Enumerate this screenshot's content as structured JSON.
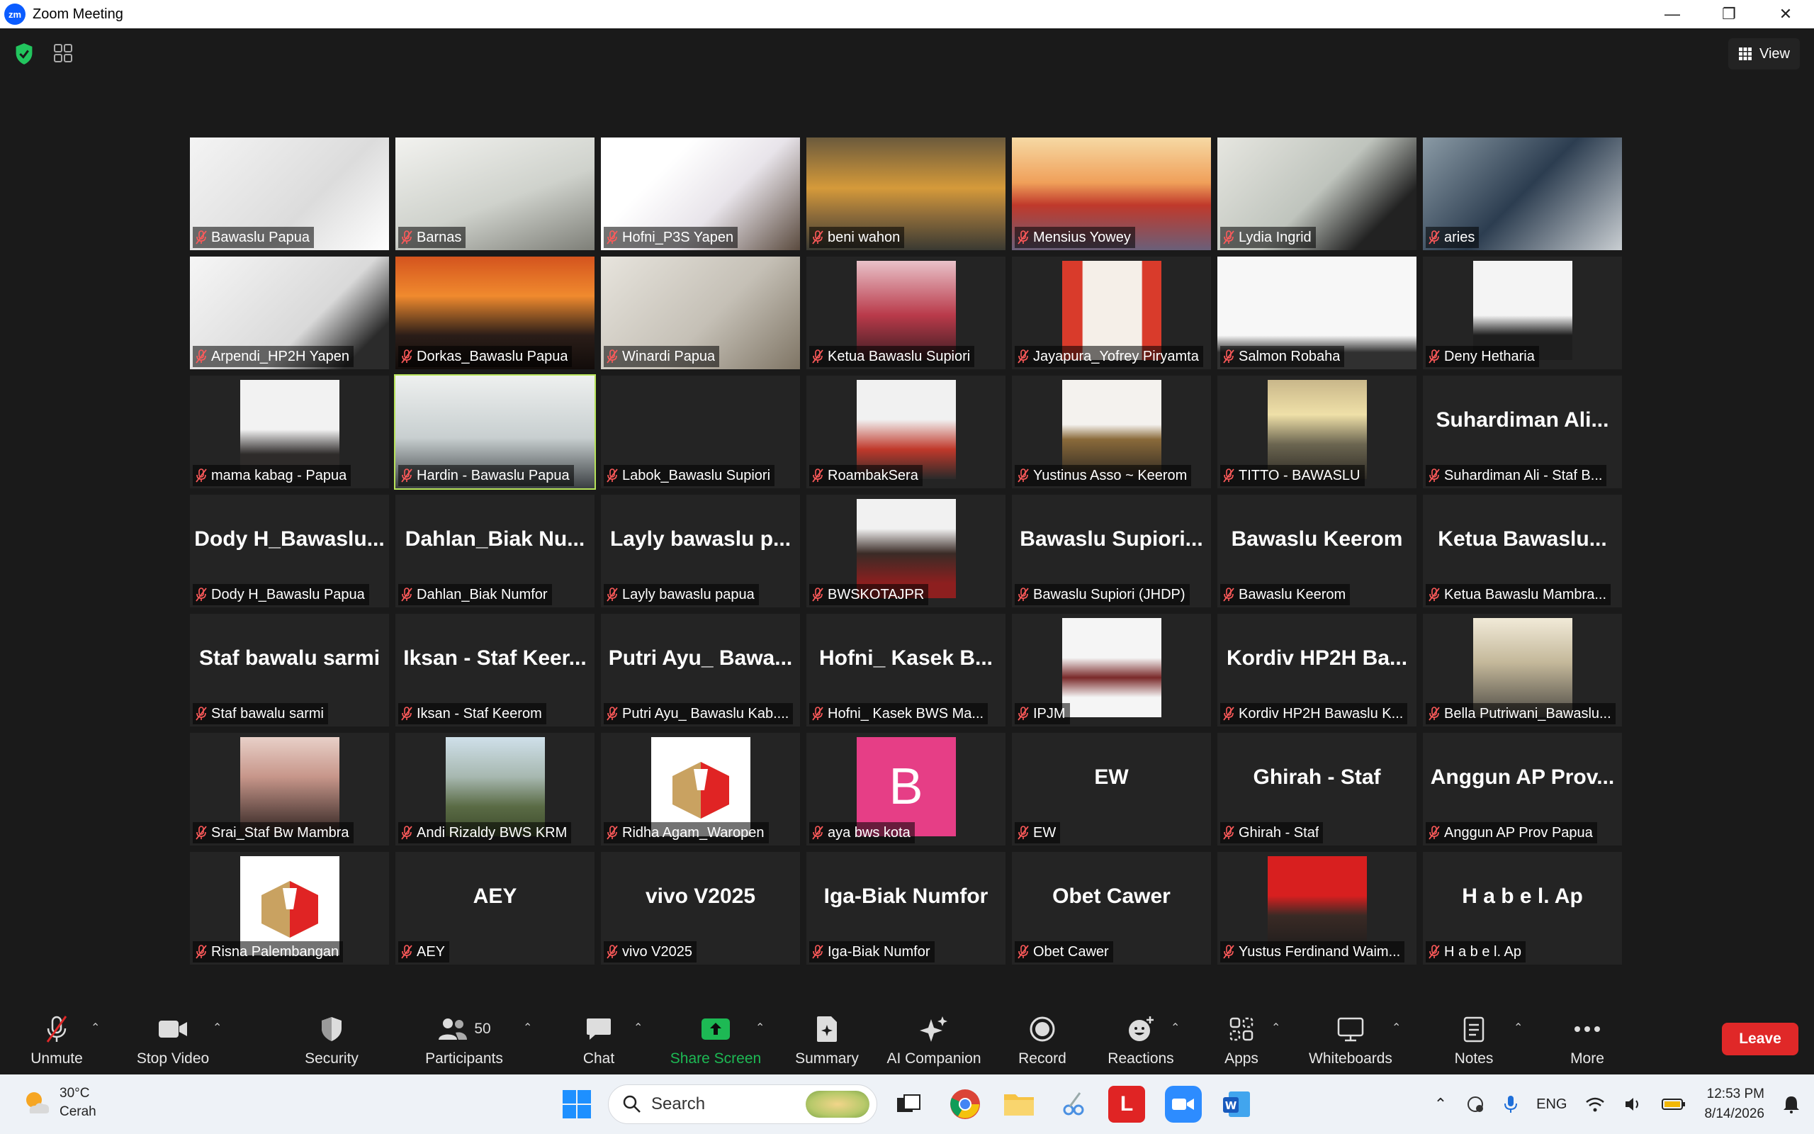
{
  "window": {
    "title": "Zoom Meeting",
    "logo_text": "zm"
  },
  "top": {
    "view_label": "View"
  },
  "tiles": [
    {
      "name": "Bawaslu Papua",
      "kind": "video",
      "bg": "linear-gradient(135deg,#f4f4f4,#dcdcdc 60%,#ffffff)"
    },
    {
      "name": "Barnas",
      "kind": "video",
      "bg": "linear-gradient(160deg,#f2f2ef,#cfd2cc 55%,#7e7f78)"
    },
    {
      "name": "Hofni_P3S Yapen",
      "kind": "video",
      "bg": "linear-gradient(135deg,#ffffff 30%,#e8e4ea 60%,#5b4b3f)"
    },
    {
      "name": "beni wahon",
      "kind": "video",
      "bg": "linear-gradient(180deg,#6b5a3c,#d59a3a 45%,#8b6a3a 70%,#3a3a32)"
    },
    {
      "name": "Mensius Yowey",
      "kind": "video",
      "bg": "linear-gradient(180deg,#f6d9a4,#f0a05a 40%,#c0392b 60%,#6a5f79)"
    },
    {
      "name": "Lydia Ingrid",
      "kind": "video",
      "bg": "linear-gradient(135deg,#e6e6e0,#bfc4bd 50%,#222 80%)"
    },
    {
      "name": "aries",
      "kind": "video",
      "bg": "linear-gradient(135deg,#8a9aa5,#2c3d50 50%,#c9ced2)"
    },
    {
      "name": "Arpendi_HP2H Yapen",
      "kind": "video",
      "bg": "linear-gradient(135deg,#f6f6f6,#d9d9d9 60%,#2b2b2b 85%)"
    },
    {
      "name": "Dorkas_Bawaslu Papua",
      "kind": "video",
      "bg": "linear-gradient(180deg,#d4541e,#f08a2e 35%,#2a1d18 70%,#120c0a)"
    },
    {
      "name": "Winardi Papua",
      "kind": "video",
      "bg": "linear-gradient(135deg,#e7e4dd,#c5c0b6 55%,#7f7565)"
    },
    {
      "name": "Ketua Bawaslu Supiori",
      "kind": "pic",
      "bg": "linear-gradient(180deg,#e9c2c9,#b93a4a 55%,#3b1d22)"
    },
    {
      "name": "Jayapura_Yofrey Piryamta",
      "kind": "pic",
      "bg": "linear-gradient(90deg,#d93b2b 20%,#f5efe8 21%,#f5efe8 80%,#d93b2b 81%)"
    },
    {
      "name": "Salmon Robaha",
      "kind": "video",
      "bg": "linear-gradient(180deg,#f7f7f7 70%,#303030 85%)"
    },
    {
      "name": "Deny Hetharia",
      "kind": "pic",
      "bg": "linear-gradient(180deg,#f4f4f4 55%,#1e1e1e 75%)"
    },
    {
      "name": "mama kabag - Papua",
      "kind": "pic",
      "bg": "linear-gradient(180deg,#f2f2f2 50%,#2e2b2a 75%)"
    },
    {
      "name": "Hardin - Bawaslu Papua",
      "kind": "video",
      "bg": "linear-gradient(180deg,#eef0ef,#c8cfd0 55%,#3a3f42)",
      "active": true
    },
    {
      "name": "Labok_Bawaslu Supiori",
      "kind": "blank"
    },
    {
      "name": "RoambakSera",
      "kind": "pic",
      "bg": "linear-gradient(180deg,#f1f1f1 40%,#c0392b 70%,#2a2a2a)"
    },
    {
      "name": "Yustinus Asso ~ Keerom",
      "kind": "pic",
      "bg": "linear-gradient(180deg,#f4f2ee 45%,#8a6a3a 60%,#2c2722)"
    },
    {
      "name": "TITTO - BAWASLU",
      "kind": "pic",
      "bg": "linear-gradient(180deg,#c9b78a,#efe0a8 35%,#6b6550 65%,#2e2b25)"
    },
    {
      "name": "Suhardiman Ali - Staf B...",
      "kind": "text",
      "display": "Suhardiman  Ali..."
    },
    {
      "name": "Dody H_Bawaslu Papua",
      "kind": "text",
      "display": "Dody  H_Bawaslu..."
    },
    {
      "name": "Dahlan_Biak Numfor",
      "kind": "text",
      "display": "Dahlan_Biak  Nu..."
    },
    {
      "name": "Layly bawaslu papua",
      "kind": "text",
      "display": "Layly  bawaslu  p..."
    },
    {
      "name": "BWSKOTAJPR",
      "kind": "pic",
      "bg": "linear-gradient(180deg,#f1f1f1 30%,#3a2b26 55%,#8d1f1f 85%)"
    },
    {
      "name": "Bawaslu Supiori (JHDP)",
      "kind": "text",
      "display": "Bawaslu  Supiori..."
    },
    {
      "name": "Bawaslu Keerom",
      "kind": "text",
      "display": "Bawaslu  Keerom"
    },
    {
      "name": "Ketua Bawaslu Mambra...",
      "kind": "text",
      "display": "Ketua  Bawaslu..."
    },
    {
      "name": "Staf bawalu sarmi",
      "kind": "text",
      "display": "Staf  bawalu  sarmi"
    },
    {
      "name": "Iksan - Staf Keerom",
      "kind": "text",
      "display": "Iksan  -  Staf  Keer..."
    },
    {
      "name": "Putri Ayu_ Bawaslu Kab....",
      "kind": "text",
      "display": "Putri  Ayu_  Bawa..."
    },
    {
      "name": "Hofni_ Kasek BWS Ma...",
      "kind": "text",
      "display": "Hofni_  Kasek  B..."
    },
    {
      "name": "IPJM",
      "kind": "pic",
      "bg": "linear-gradient(180deg,#f5f5f5 40%,#7a2a2a 60%,#f5f5f5 80%)"
    },
    {
      "name": "Kordiv HP2H Bawaslu K...",
      "kind": "text",
      "display": "Kordiv  HP2H  Ba..."
    },
    {
      "name": "Bella Putriwani_Bawaslu...",
      "kind": "pic",
      "bg": "linear-gradient(180deg,#f1ead8,#c4b89a 45%,#4d4a44)"
    },
    {
      "name": "Srai_Staf Bw Mambra",
      "kind": "pic",
      "bg": "linear-gradient(180deg,#e8d0c8,#c7968a 40%,#2a1f1d)"
    },
    {
      "name": "Andi Rizaldy BWS KRM",
      "kind": "pic",
      "bg": "linear-gradient(180deg,#cfe0ea,#a7b8b0 40%,#5a6b45 70%,#3d4a2b)"
    },
    {
      "name": "Ridha Agam_Waropen",
      "kind": "logo"
    },
    {
      "name": "aya bws kota",
      "kind": "letter",
      "letter": "B",
      "color": "#e63e86"
    },
    {
      "name": "EW",
      "kind": "text",
      "display": "EW"
    },
    {
      "name": "Ghirah - Staf",
      "kind": "text",
      "display": "Ghirah  -  Staf"
    },
    {
      "name": "Anggun AP Prov Papua",
      "kind": "text",
      "display": "Anggun  AP  Prov..."
    },
    {
      "name": "Risna Palembangan",
      "kind": "logo"
    },
    {
      "name": "AEY",
      "kind": "text",
      "display": "AEY"
    },
    {
      "name": "vivo V2025",
      "kind": "text",
      "display": "vivo  V2025"
    },
    {
      "name": "Iga-Biak Numfor",
      "kind": "text",
      "display": "Iga-Biak  Numfor"
    },
    {
      "name": "Obet Cawer",
      "kind": "text",
      "display": "Obet  Cawer"
    },
    {
      "name": "Yustus Ferdinand Waim...",
      "kind": "pic",
      "bg": "linear-gradient(180deg,#d81f1f 40%,#3a2a25 60%,#1b1b1b)"
    },
    {
      "name": "H a b e l.  Ap",
      "kind": "text",
      "display": "H a b e l.   Ap"
    }
  ],
  "toolbar": {
    "unmute": "Unmute",
    "stop_video": "Stop Video",
    "security": "Security",
    "participants": "Participants",
    "participants_count": "50",
    "chat": "Chat",
    "share_screen": "Share Screen",
    "summary": "Summary",
    "ai_companion": "AI Companion",
    "record": "Record",
    "reactions": "Reactions",
    "apps": "Apps",
    "whiteboards": "Whiteboards",
    "notes": "Notes",
    "more": "More",
    "leave": "Leave",
    "accent": "#1db954",
    "leave_color": "#e02828"
  },
  "taskbar": {
    "temperature": "30°C",
    "weather": "Cerah",
    "search_placeholder": "Search",
    "lang": "ENG",
    "time": "12:53 PM",
    "date": "8/14/2026"
  }
}
